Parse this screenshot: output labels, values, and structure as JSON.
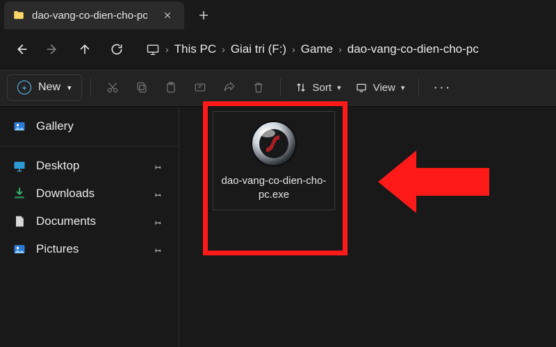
{
  "tab": {
    "title": "dao-vang-co-dien-cho-pc"
  },
  "breadcrumbs": {
    "root_icon": "this-pc",
    "items": [
      "This PC",
      "Giai tri (F:)",
      "Game",
      "dao-vang-co-dien-cho-pc"
    ]
  },
  "toolbar": {
    "new_label": "New",
    "sort_label": "Sort",
    "view_label": "View"
  },
  "sidebar": {
    "gallery": "Gallery",
    "items": [
      {
        "label": "Desktop",
        "icon": "desktop"
      },
      {
        "label": "Downloads",
        "icon": "downloads"
      },
      {
        "label": "Documents",
        "icon": "documents"
      },
      {
        "label": "Pictures",
        "icon": "pictures"
      }
    ]
  },
  "file": {
    "name": "dao-vang-co-dien-cho-pc.exe",
    "icon": "flash-player"
  },
  "annotation": {
    "color": "#ff1a1a"
  }
}
